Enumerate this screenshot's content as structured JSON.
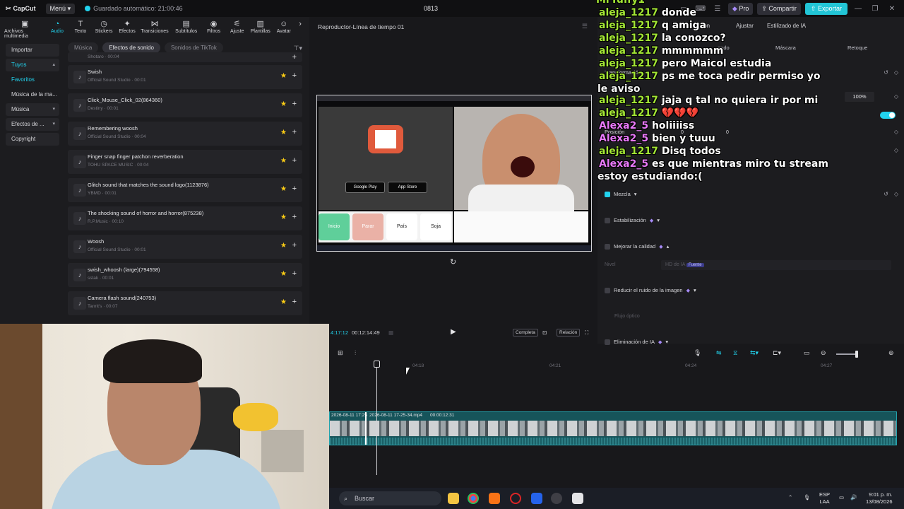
{
  "app": {
    "logo": "CapCut",
    "menu": "Menú",
    "autosave": "Guardado automático: 21:00:46",
    "project": "0813",
    "pro": "Pro",
    "share": "Compartir",
    "export": "Exportar"
  },
  "tools": [
    {
      "label": "Archivos multimedia",
      "icon": "media-icon"
    },
    {
      "label": "Audio",
      "icon": "audio-icon",
      "active": true
    },
    {
      "label": "Texto",
      "icon": "text-icon"
    },
    {
      "label": "Stickers",
      "icon": "sticker-icon"
    },
    {
      "label": "Efectos",
      "icon": "effects-icon"
    },
    {
      "label": "Transiciones",
      "icon": "transitions-icon"
    },
    {
      "label": "Subtítulos",
      "icon": "subtitles-icon"
    },
    {
      "label": "Filtros",
      "icon": "filter-icon"
    },
    {
      "label": "Ajuste",
      "icon": "adjust-icon"
    },
    {
      "label": "Plantillas",
      "icon": "templates-icon"
    },
    {
      "label": "Avatar",
      "icon": "avatar-icon"
    }
  ],
  "leftnav": {
    "importar": "Importar",
    "tuyos": "Tuyos",
    "favoritos": "Favoritos",
    "musica_ma": "Música de la ma...",
    "musica": "Música",
    "efectos": "Efectos de ...",
    "copyright": "Copyright"
  },
  "subtabs": {
    "musica": "Música",
    "efectos": "Efectos de sonido",
    "tiktok": "Sonidos de TikTok"
  },
  "sounds": {
    "partial_meta": "Shotaro · 00:04",
    "items": [
      {
        "name": "Swish",
        "meta": "Official Sound Studio · 00:01"
      },
      {
        "name": "Click_Mouse_Click_02(864360)",
        "meta": "Destiny · 00:01"
      },
      {
        "name": "Remembering woosh",
        "meta": "Official Sound Studio · 00:04"
      },
      {
        "name": "Finger snap finger patchon reverberation",
        "meta": "TOHU SPACE MUSIC · 00:04"
      },
      {
        "name": "Glitch sound that matches the sound logo(1123876)",
        "meta": "YBMD · 00:01"
      },
      {
        "name": "The shocking sound of horror and horror(875238)",
        "meta": "R.P.Music · 00:10"
      },
      {
        "name": "Woosh",
        "meta": "Official Sound Studio · 00:01"
      },
      {
        "name": "swish_whoosh (large)(794558)",
        "meta": "sstak · 00:01"
      },
      {
        "name": "Camera flash sound(240753)",
        "meta": "Tanrit's · 00:07"
      }
    ]
  },
  "player": {
    "title": "Reproductor-Línea de tiempo 01",
    "time_current": "00:12:49",
    "time_prefix": "4:17:12",
    "time_total": "00:12:14:49",
    "completa": "Completa",
    "relacion": "Relación",
    "preview": {
      "inicio": "Inicio",
      "parar": "Parar",
      "pais": "País",
      "soja": "Soja",
      "google_play": "Google Play",
      "app_store": "App Store"
    }
  },
  "rightpanel": {
    "tabs": [
      "ación",
      "Ajustar",
      "Estilizado de IA"
    ],
    "subtabs": [
      "ondo",
      "Máscara",
      "Retoque"
    ],
    "transformacion": "Transformación",
    "escala": "100%",
    "posicion": "Posición",
    "pos_x": "0",
    "pos_y": "0",
    "mezcla": "Mezcla",
    "estabilizacion": "Estabilización",
    "mejorar": "Mejorar la calidad",
    "nivel": "Nivel",
    "hd": "HD de IA",
    "fuente": "Fuente",
    "reducir": "Reducir el ruido de la imagen",
    "flujo": "Flujo óptico",
    "eliminacion": "Eliminación de IA"
  },
  "chat": [
    {
      "user": "MrTuffy1",
      "msg": "",
      "color": "green"
    },
    {
      "user": "aleja_1217",
      "msg": "donde",
      "color": "green"
    },
    {
      "user": "aleja_1217",
      "msg": "q amiga",
      "color": "green"
    },
    {
      "user": "aleja_1217",
      "msg": "la conozco?",
      "color": "green"
    },
    {
      "user": "aleja_1217",
      "msg": "mmmmmm",
      "color": "green"
    },
    {
      "user": "aleja_1217",
      "msg": "pero Maicol estudia",
      "color": "green"
    },
    {
      "user": "aleja_1217",
      "msg": "ps me toca pedir permiso yo",
      "color": "green"
    },
    {
      "user": "",
      "msg": "le aviso",
      "color": "white"
    },
    {
      "user": "aleja_1217",
      "msg": "jaja q tal no quiera ir por mi",
      "color": "green"
    },
    {
      "user": "aleja_1217",
      "msg": "💔💔💔",
      "color": "green"
    },
    {
      "user": "Alexa2_5",
      "msg": "holiiiiss",
      "color": "pink"
    },
    {
      "user": "Alexa2_5",
      "msg": "bien y tuuu",
      "color": "pink"
    },
    {
      "user": "aleja_1217",
      "msg": "Disq todos",
      "color": "green"
    },
    {
      "user": "Alexa2_5",
      "msg": "es que mientras miro tu stream",
      "color": "pink"
    },
    {
      "user": "",
      "msg": "estoy estudiando:(",
      "color": "white"
    }
  ],
  "timeline": {
    "ticks": [
      "04:18",
      "04:21",
      "04:24",
      "04:27"
    ],
    "clip1": "2026-08-11 17:25",
    "clip2": "2026-08-11 17-25-34.mp4",
    "clip2_dur": "00:00:12:31"
  },
  "taskbar": {
    "search": "Buscar",
    "lang": "ESP",
    "lang2": "LAA",
    "time": "9:01 p. m.",
    "date": "13/08/2026"
  },
  "colors": {
    "accent": "#22d3ee",
    "chat_green": "#a3e635",
    "chat_pink": "#e879f9",
    "star": "#facc15"
  }
}
